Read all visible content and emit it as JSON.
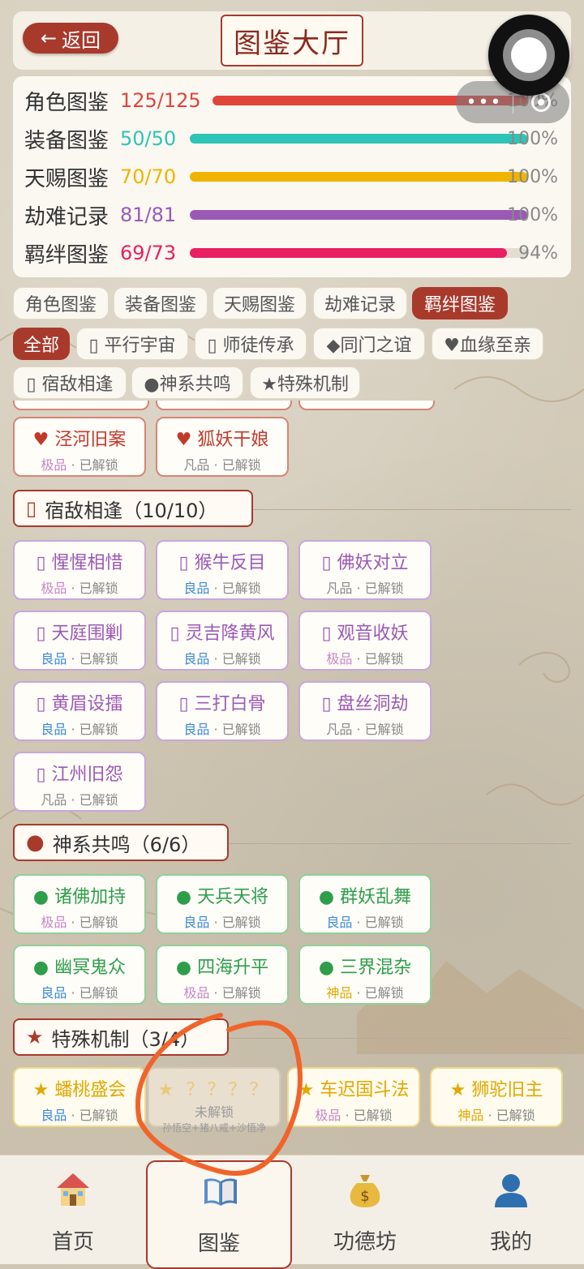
{
  "header": {
    "back_label": "返回",
    "back_arrow": "←",
    "title": "图鉴大厅"
  },
  "progress": [
    {
      "label": "角色图鉴",
      "count": "125/125",
      "percent": "100%",
      "fraction": 1.0,
      "color": "#e0443a"
    },
    {
      "label": "装备图鉴",
      "count": "50/50",
      "percent": "100%",
      "fraction": 1.0,
      "color": "#2ec4b6"
    },
    {
      "label": "天赐图鉴",
      "count": "70/70",
      "percent": "100%",
      "fraction": 1.0,
      "color": "#f0b400"
    },
    {
      "label": "劫难记录",
      "count": "81/81",
      "percent": "100%",
      "fraction": 1.0,
      "color": "#9b59b6"
    },
    {
      "label": "羁绊图鉴",
      "count": "69/73",
      "percent": "94%",
      "fraction": 0.94,
      "color": "#e91e63"
    }
  ],
  "main_tabs": [
    "角色图鉴",
    "装备图鉴",
    "天赐图鉴",
    "劫难记录",
    "羁绊图鉴"
  ],
  "filter_tabs": [
    "全部",
    "▯ 平行宇宙",
    "▯ 师徒传承",
    "◆同门之谊",
    "♥血缘至亲",
    "▯ 宿敌相逢",
    "●神系共鸣",
    "★特殊机制"
  ],
  "status_unlocked": "已解锁",
  "dot": "·",
  "kin_cards": [
    {
      "icon": "♥",
      "name": "泾河旧案",
      "grade": "极品"
    },
    {
      "icon": "♥",
      "name": "狐妖干娘",
      "grade": "凡品"
    }
  ],
  "rival_section": {
    "icon": "▯",
    "title": "宿敌相逢（10/10）"
  },
  "rival_cards": [
    {
      "icon": "▯",
      "name": "惺惺相惜",
      "grade": "极品"
    },
    {
      "icon": "▯",
      "name": "猴牛反目",
      "grade": "良品"
    },
    {
      "icon": "▯",
      "name": "佛妖对立",
      "grade": "凡品"
    },
    {
      "icon": "▯",
      "name": "天庭围剿",
      "grade": "良品"
    },
    {
      "icon": "▯",
      "name": "灵吉降黄风",
      "grade": "良品"
    },
    {
      "icon": "▯",
      "name": "观音收妖",
      "grade": "极品"
    },
    {
      "icon": "▯",
      "name": "黄眉设擂",
      "grade": "良品"
    },
    {
      "icon": "▯",
      "name": "三打白骨",
      "grade": "良品"
    },
    {
      "icon": "▯",
      "name": "盘丝洞劫",
      "grade": "凡品"
    },
    {
      "icon": "▯",
      "name": "江州旧怨",
      "grade": "凡品"
    }
  ],
  "god_section": {
    "icon": "●",
    "title": "神系共鸣（6/6）"
  },
  "god_cards": [
    {
      "icon": "●",
      "name": "诸佛加持",
      "grade": "极品"
    },
    {
      "icon": "●",
      "name": "天兵天将",
      "grade": "良品"
    },
    {
      "icon": "●",
      "name": "群妖乱舞",
      "grade": "良品"
    },
    {
      "icon": "●",
      "name": "幽冥鬼众",
      "grade": "良品"
    },
    {
      "icon": "●",
      "name": "四海升平",
      "grade": "极品"
    },
    {
      "icon": "●",
      "name": "三界混杂",
      "grade": "神品"
    }
  ],
  "special_section": {
    "icon": "★",
    "title": "特殊机制（3/4）"
  },
  "special_cards": [
    {
      "icon": "★",
      "name": "蟠桃盛会",
      "grade": "良品"
    },
    {
      "icon": "★",
      "name": "？？？？",
      "status": "未解锁",
      "hint": "孙悟空+猪八戒+沙悟净"
    },
    {
      "icon": "★",
      "name": "车迟国斗法",
      "grade": "极品"
    },
    {
      "icon": "★",
      "name": "狮驼旧主",
      "grade": "神品"
    }
  ],
  "capsule": {
    "dots": "•••"
  },
  "nav": [
    "首页",
    "图鉴",
    "功德坊",
    "我的"
  ],
  "colors": {
    "accent": "#a83a2c",
    "annotation": "#f0642a"
  }
}
